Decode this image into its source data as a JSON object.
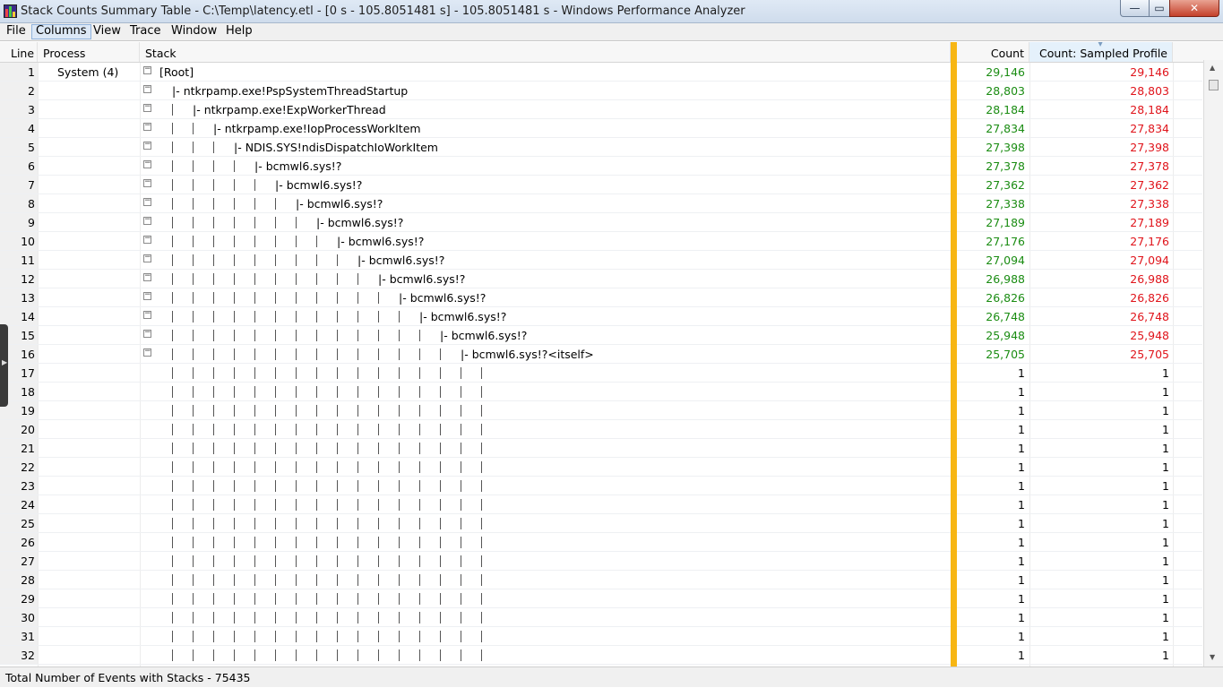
{
  "window": {
    "title": "Stack Counts Summary Table - C:\\Temp\\latency.etl - [0 s - 105.8051481 s] - 105.8051481 s - Windows Performance Analyzer",
    "min_icon": "minimize-icon",
    "max_icon": "maximize-icon",
    "close_icon": "close-icon",
    "min_glyph": "—",
    "max_glyph": "▭",
    "close_glyph": "✕"
  },
  "menu": [
    "File",
    "Columns",
    "View",
    "Trace",
    "Window",
    "Help"
  ],
  "menu_active": "Columns",
  "table": {
    "headers": {
      "line": "Line",
      "process": "Process",
      "stack": "Stack",
      "count": "Count",
      "sampled": "Count: Sampled Profile"
    },
    "sorted_column": "Count: Sampled Profile",
    "rows": [
      {
        "line": "1",
        "process": "System (4)",
        "depth": 0,
        "frame": "[Root]",
        "count": "29,146",
        "sampled": "29,146",
        "expand": true
      },
      {
        "line": "2",
        "process": "",
        "depth": 1,
        "frame": "ntkrpamp.exe!PspSystemThreadStartup",
        "count": "28,803",
        "sampled": "28,803",
        "expand": true
      },
      {
        "line": "3",
        "process": "",
        "depth": 2,
        "frame": "ntkrpamp.exe!ExpWorkerThread",
        "count": "28,184",
        "sampled": "28,184",
        "expand": true
      },
      {
        "line": "4",
        "process": "",
        "depth": 3,
        "frame": "ntkrpamp.exe!IopProcessWorkItem",
        "count": "27,834",
        "sampled": "27,834",
        "expand": true
      },
      {
        "line": "5",
        "process": "",
        "depth": 4,
        "frame": "NDIS.SYS!ndisDispatchIoWorkItem",
        "count": "27,398",
        "sampled": "27,398",
        "expand": true
      },
      {
        "line": "6",
        "process": "",
        "depth": 5,
        "frame": "bcmwl6.sys!?",
        "count": "27,378",
        "sampled": "27,378",
        "expand": true
      },
      {
        "line": "7",
        "process": "",
        "depth": 6,
        "frame": "bcmwl6.sys!?",
        "count": "27,362",
        "sampled": "27,362",
        "expand": true
      },
      {
        "line": "8",
        "process": "",
        "depth": 7,
        "frame": "bcmwl6.sys!?",
        "count": "27,338",
        "sampled": "27,338",
        "expand": true
      },
      {
        "line": "9",
        "process": "",
        "depth": 8,
        "frame": "bcmwl6.sys!?",
        "count": "27,189",
        "sampled": "27,189",
        "expand": true
      },
      {
        "line": "10",
        "process": "",
        "depth": 9,
        "frame": "bcmwl6.sys!?",
        "count": "27,176",
        "sampled": "27,176",
        "expand": true
      },
      {
        "line": "11",
        "process": "",
        "depth": 10,
        "frame": "bcmwl6.sys!?",
        "count": "27,094",
        "sampled": "27,094",
        "expand": true
      },
      {
        "line": "12",
        "process": "",
        "depth": 11,
        "frame": "bcmwl6.sys!?",
        "count": "26,988",
        "sampled": "26,988",
        "expand": true
      },
      {
        "line": "13",
        "process": "",
        "depth": 12,
        "frame": "bcmwl6.sys!?",
        "count": "26,826",
        "sampled": "26,826",
        "expand": true
      },
      {
        "line": "14",
        "process": "",
        "depth": 13,
        "frame": "bcmwl6.sys!?",
        "count": "26,748",
        "sampled": "26,748",
        "expand": true
      },
      {
        "line": "15",
        "process": "",
        "depth": 14,
        "frame": "bcmwl6.sys!?",
        "count": "25,948",
        "sampled": "25,948",
        "expand": true
      },
      {
        "line": "16",
        "process": "",
        "depth": 15,
        "frame": "bcmwl6.sys!?<itself>",
        "count": "25,705",
        "sampled": "25,705",
        "expand": true
      },
      {
        "line": "17",
        "process": "",
        "depth": 15,
        "frame": "",
        "count": "1",
        "sampled": "1",
        "expand": false
      },
      {
        "line": "18",
        "process": "",
        "depth": 15,
        "frame": "",
        "count": "1",
        "sampled": "1",
        "expand": false
      },
      {
        "line": "19",
        "process": "",
        "depth": 15,
        "frame": "",
        "count": "1",
        "sampled": "1",
        "expand": false
      },
      {
        "line": "20",
        "process": "",
        "depth": 15,
        "frame": "",
        "count": "1",
        "sampled": "1",
        "expand": false
      },
      {
        "line": "21",
        "process": "",
        "depth": 15,
        "frame": "",
        "count": "1",
        "sampled": "1",
        "expand": false
      },
      {
        "line": "22",
        "process": "",
        "depth": 15,
        "frame": "",
        "count": "1",
        "sampled": "1",
        "expand": false
      },
      {
        "line": "23",
        "process": "",
        "depth": 15,
        "frame": "",
        "count": "1",
        "sampled": "1",
        "expand": false
      },
      {
        "line": "24",
        "process": "",
        "depth": 15,
        "frame": "",
        "count": "1",
        "sampled": "1",
        "expand": false
      },
      {
        "line": "25",
        "process": "",
        "depth": 15,
        "frame": "",
        "count": "1",
        "sampled": "1",
        "expand": false
      },
      {
        "line": "26",
        "process": "",
        "depth": 15,
        "frame": "",
        "count": "1",
        "sampled": "1",
        "expand": false
      },
      {
        "line": "27",
        "process": "",
        "depth": 15,
        "frame": "",
        "count": "1",
        "sampled": "1",
        "expand": false
      },
      {
        "line": "28",
        "process": "",
        "depth": 15,
        "frame": "",
        "count": "1",
        "sampled": "1",
        "expand": false
      },
      {
        "line": "29",
        "process": "",
        "depth": 15,
        "frame": "",
        "count": "1",
        "sampled": "1",
        "expand": false
      },
      {
        "line": "30",
        "process": "",
        "depth": 15,
        "frame": "",
        "count": "1",
        "sampled": "1",
        "expand": false
      },
      {
        "line": "31",
        "process": "",
        "depth": 15,
        "frame": "",
        "count": "1",
        "sampled": "1",
        "expand": false
      },
      {
        "line": "32",
        "process": "",
        "depth": 15,
        "frame": "",
        "count": "1",
        "sampled": "1",
        "expand": false
      }
    ]
  },
  "status": "Total Number of Events with Stacks - 75435",
  "colors": {
    "count_text": "#1a8c12",
    "sampled_text": "#e0141b",
    "gold_bar": "#f7b614",
    "sorted_header_bg": "#e5f1fb"
  },
  "glyphs": {
    "toggle": "−",
    "sort_arrow": "▼",
    "scroll_up": "▲",
    "scroll_down": "▼",
    "side_handle": "▶"
  }
}
